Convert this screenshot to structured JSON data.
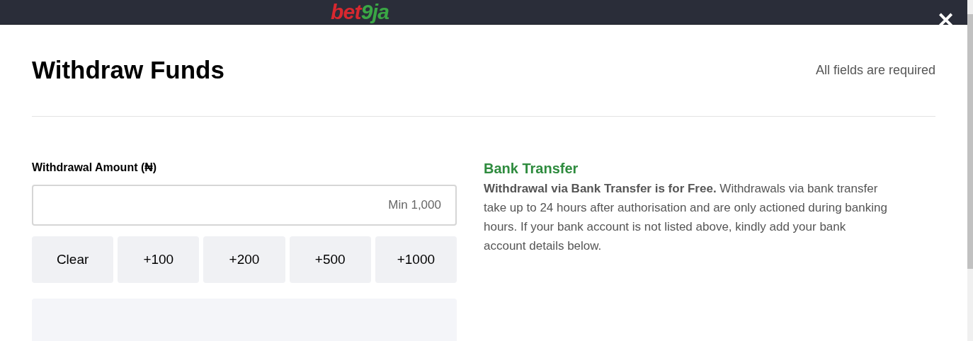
{
  "header": {
    "logo": [
      {
        "text": "bet",
        "color": "#d7282f"
      },
      {
        "text": "9ja",
        "color": "#3aa745"
      }
    ],
    "close": "✕"
  },
  "title": "Withdraw Funds",
  "required_note": "All fields are required",
  "amount": {
    "label": "Withdrawal Amount (₦)",
    "placeholder": "Min 1,000"
  },
  "quick_buttons": [
    "Clear",
    "+100",
    "+200",
    "+500",
    "+1000"
  ],
  "info": {
    "title": "Bank Transfer",
    "text": "**Withdrawal via Bank Transfer is for Free.** Withdrawals via bank transfer take up to 24 hours after authorisation and are only actioned during banking hours. If your bank account is not listed above, kindly add your bank account details below."
  }
}
